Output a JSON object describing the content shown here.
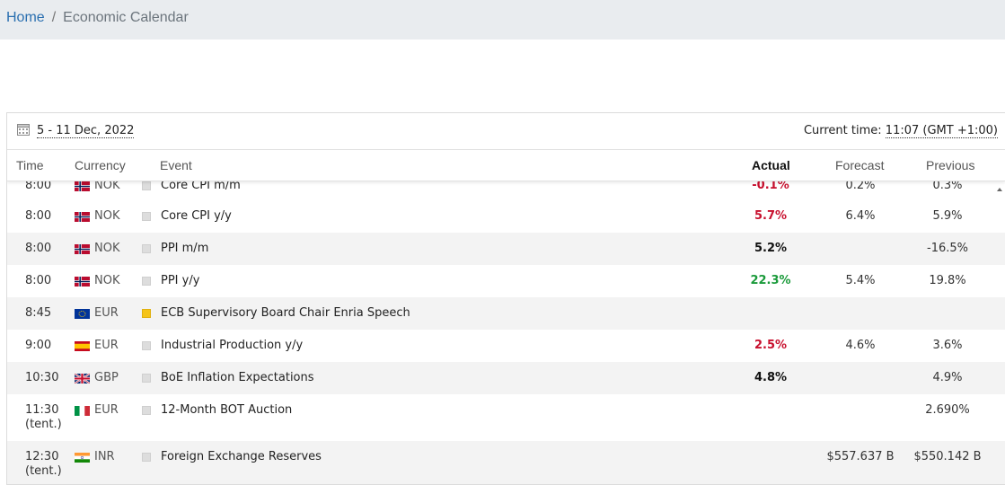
{
  "breadcrumb": {
    "home": "Home",
    "separator": "/",
    "current": "Economic Calendar"
  },
  "toolbar": {
    "date_range": "5 - 11 Dec, 2022",
    "current_time_label": "Current time:",
    "current_time_value": "11:07 (GMT +1:00)"
  },
  "columns": {
    "time": "Time",
    "currency": "Currency",
    "event": "Event",
    "actual": "Actual",
    "forecast": "Forecast",
    "previous": "Previous"
  },
  "colors": {
    "positive": "#1a9a3a",
    "negative": "#c8102e",
    "neutral": "#111111",
    "row_alt": "#f3f3f3",
    "importance_high": "#f5c419",
    "importance_low": "#dddddd"
  },
  "events": [
    {
      "time": "8:00",
      "time_note": "",
      "flag": "norway-flag-icon",
      "currency": "NOK",
      "importance": "low",
      "event": "Core CPI m/m",
      "actual": "-0.1%",
      "actual_tone": "negative",
      "forecast": "0.2%",
      "previous": "0.3%"
    },
    {
      "time": "8:00",
      "time_note": "",
      "flag": "norway-flag-icon",
      "currency": "NOK",
      "importance": "low",
      "event": "Core CPI y/y",
      "actual": "5.7%",
      "actual_tone": "negative",
      "forecast": "6.4%",
      "previous": "5.9%"
    },
    {
      "time": "8:00",
      "time_note": "",
      "flag": "norway-flag-icon",
      "currency": "NOK",
      "importance": "low",
      "event": "PPI m/m",
      "actual": "5.2%",
      "actual_tone": "neutral",
      "forecast": "",
      "previous": "-16.5%"
    },
    {
      "time": "8:00",
      "time_note": "",
      "flag": "norway-flag-icon",
      "currency": "NOK",
      "importance": "low",
      "event": "PPI y/y",
      "actual": "22.3%",
      "actual_tone": "positive",
      "forecast": "5.4%",
      "previous": "19.8%"
    },
    {
      "time": "8:45",
      "time_note": "",
      "flag": "eu-flag-icon",
      "currency": "EUR",
      "importance": "high",
      "event": "ECB Supervisory Board Chair Enria Speech",
      "actual": "",
      "actual_tone": "neutral",
      "forecast": "",
      "previous": ""
    },
    {
      "time": "9:00",
      "time_note": "",
      "flag": "spain-flag-icon",
      "currency": "EUR",
      "importance": "low",
      "event": "Industrial Production y/y",
      "actual": "2.5%",
      "actual_tone": "negative",
      "forecast": "4.6%",
      "previous": "3.6%"
    },
    {
      "time": "10:30",
      "time_note": "",
      "flag": "uk-flag-icon",
      "currency": "GBP",
      "importance": "low",
      "event": "BoE Inflation Expectations",
      "actual": "4.8%",
      "actual_tone": "neutral",
      "forecast": "",
      "previous": "4.9%"
    },
    {
      "time": "11:30",
      "time_note": "(tent.)",
      "flag": "italy-flag-icon",
      "currency": "EUR",
      "importance": "low",
      "event": "12-Month BOT Auction",
      "actual": "",
      "actual_tone": "neutral",
      "forecast": "",
      "previous": "2.690%"
    },
    {
      "time": "12:30",
      "time_note": "(tent.)",
      "flag": "india-flag-icon",
      "currency": "INR",
      "importance": "low",
      "event": "Foreign Exchange Reserves",
      "actual": "",
      "actual_tone": "neutral",
      "forecast": "$557.637 B",
      "previous": "$550.142 B"
    }
  ]
}
